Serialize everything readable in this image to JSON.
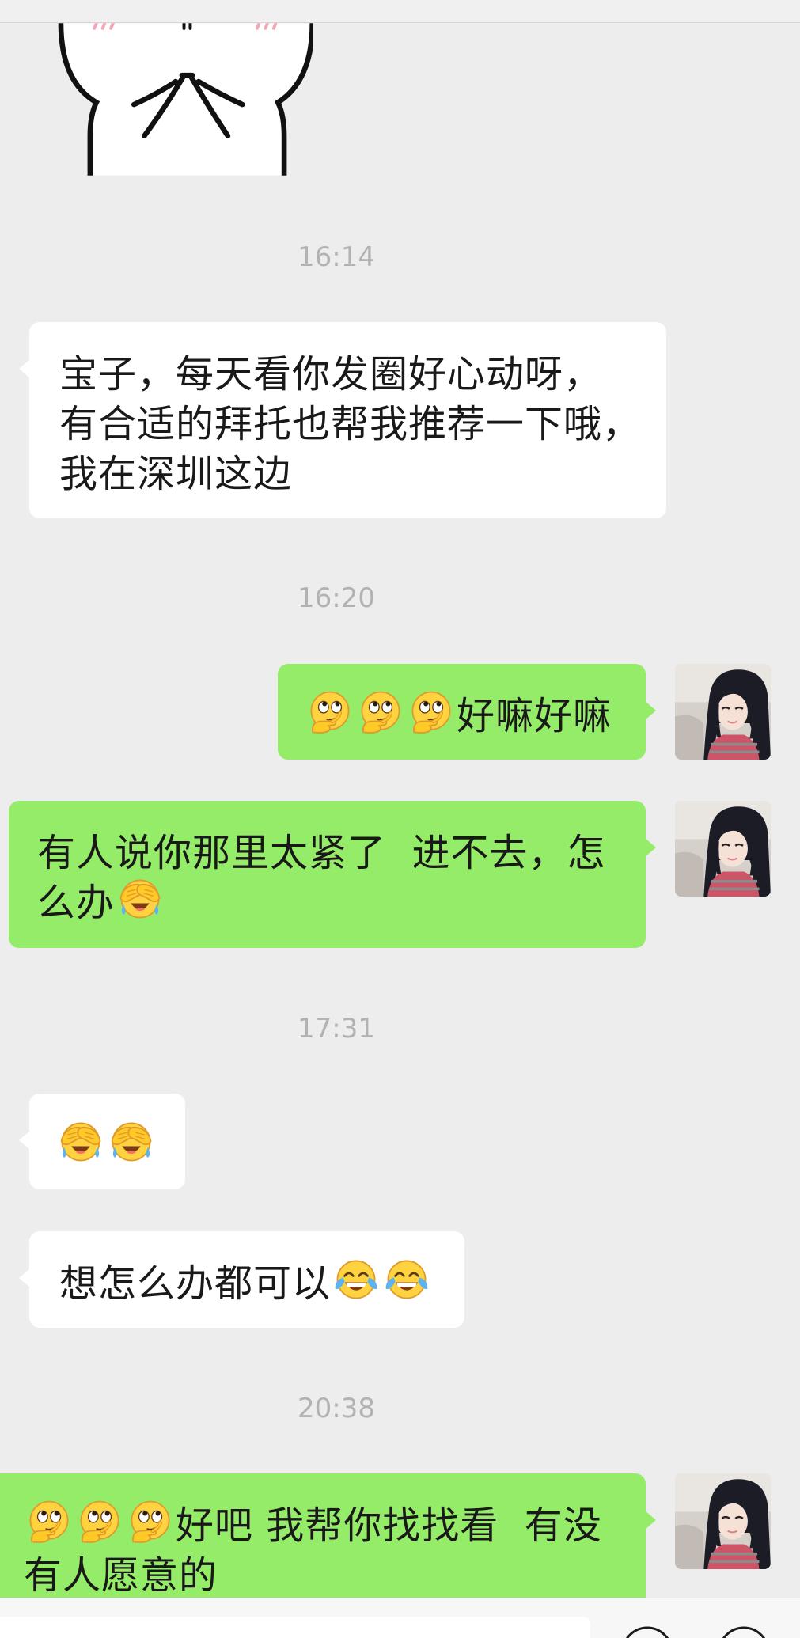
{
  "theme": {
    "background": "#ededed",
    "bubble_sent": "#95ec69",
    "bubble_received": "#ffffff",
    "timestamp_text": "#b2b2b2",
    "message_text": "#191919"
  },
  "sticker": {
    "icon": "hands-together-sticker"
  },
  "avatar": {
    "icon": "girl-photo-avatar"
  },
  "timestamps": [
    "16:14",
    "16:20",
    "17:31",
    "20:38"
  ],
  "messages": [
    {
      "lines": [
        [
          {
            "text": "宝子，每天看你发圈好心动呀，"
          }
        ],
        [
          {
            "text": "有合适的拜托也帮我推荐一下哦，"
          }
        ],
        [
          {
            "text": "我在深圳这边"
          }
        ]
      ]
    },
    {
      "lines": [
        [
          {
            "emoji": "clever-emoji"
          },
          {
            "emoji": "clever-emoji"
          },
          {
            "emoji": "clever-emoji"
          },
          {
            "text": "好嘛好嘛"
          }
        ]
      ]
    },
    {
      "lines": [
        [
          {
            "text": "有人说你那里太紧了  进不去，怎"
          }
        ],
        [
          {
            "text": "么办"
          },
          {
            "emoji": "facepalm-emoji"
          }
        ]
      ]
    },
    {
      "lines": [
        [
          {
            "emoji": "facepalm-emoji"
          },
          {
            "emoji": "facepalm-emoji"
          }
        ]
      ]
    },
    {
      "lines": [
        [
          {
            "text": "想怎么办都可以"
          },
          {
            "emoji": "tears-of-joy-emoji"
          },
          {
            "emoji": "tears-of-joy-emoji"
          }
        ]
      ]
    },
    {
      "lines": [
        [
          {
            "emoji": "clever-emoji"
          },
          {
            "emoji": "clever-emoji"
          },
          {
            "emoji": "clever-emoji"
          },
          {
            "text": "好吧 我帮你找找看  有没"
          }
        ],
        [
          {
            "text": "有人愿意的"
          }
        ]
      ]
    }
  ],
  "input_bar": {
    "icons": [
      "emoji-button-icon",
      "add-button-icon"
    ]
  }
}
